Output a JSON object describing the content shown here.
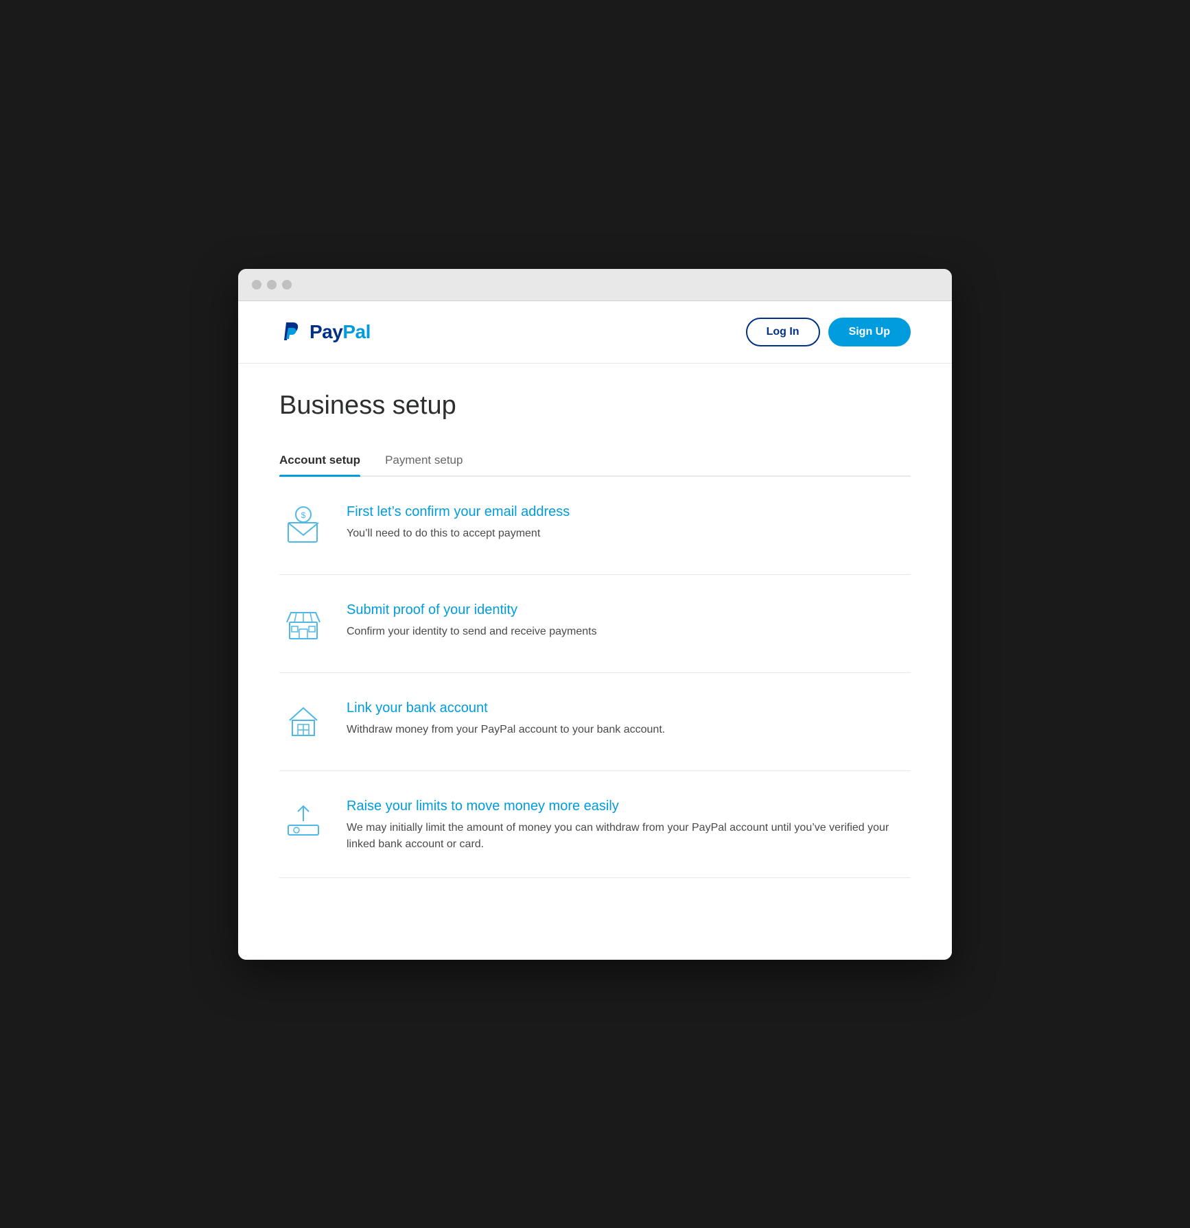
{
  "browser": {
    "traffic_lights": [
      "close",
      "minimize",
      "maximize"
    ]
  },
  "header": {
    "logo_pay": "Pay",
    "logo_pal": "Pal",
    "login_label": "Log In",
    "signup_label": "Sign Up"
  },
  "page": {
    "title": "Business setup"
  },
  "tabs": [
    {
      "id": "account-setup",
      "label": "Account setup",
      "active": true
    },
    {
      "id": "payment-setup",
      "label": "Payment setup",
      "active": false
    }
  ],
  "setup_items": [
    {
      "id": "confirm-email",
      "title": "First let’s confirm your email address",
      "description": "You’ll need to do this to accept payment",
      "icon": "email-money-icon"
    },
    {
      "id": "submit-identity",
      "title": "Submit proof of your identity",
      "description": "Confirm your identity to send and receive payments",
      "icon": "store-icon"
    },
    {
      "id": "link-bank",
      "title": "Link your bank account",
      "description": "Withdraw money from your PayPal account to your bank account.",
      "icon": "bank-icon"
    },
    {
      "id": "raise-limits",
      "title": "Raise your limits to move money more easily",
      "description": "We may initially limit the amount of money you can withdraw from your PayPal account until you’ve verified your linked bank account or card.",
      "icon": "upload-card-icon"
    }
  ],
  "colors": {
    "accent_blue": "#009cde",
    "dark_blue": "#003087",
    "text_primary": "#2c2e2f",
    "text_secondary": "#4a4a4a",
    "icon_color": "#4db8e8"
  }
}
